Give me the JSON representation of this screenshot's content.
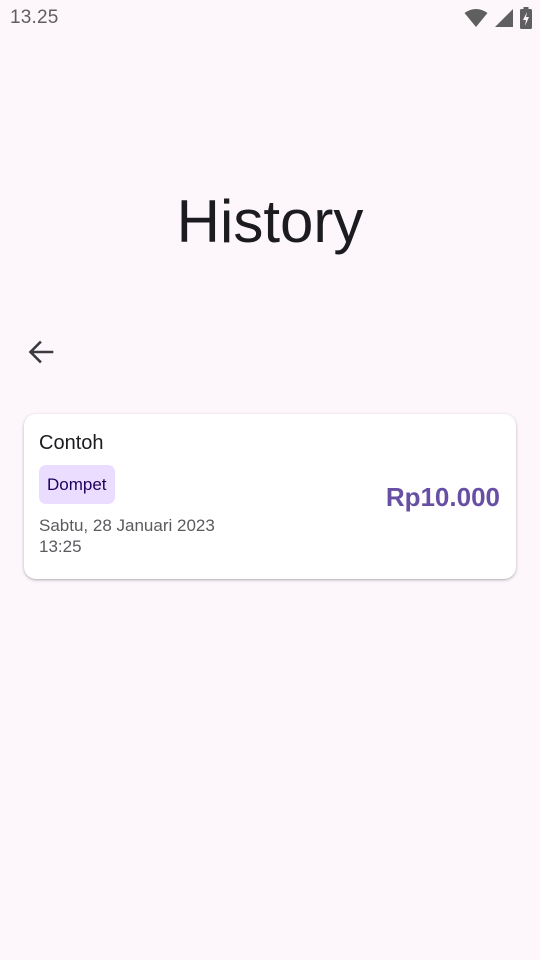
{
  "status_bar": {
    "time": "13.25",
    "icons": [
      "wifi-icon",
      "signal-icon",
      "battery-charging-icon"
    ]
  },
  "page": {
    "title": "History",
    "back_icon": "arrow-back-icon"
  },
  "transactions": [
    {
      "name": "Contoh",
      "category": "Dompet",
      "date": "Sabtu, 28 Januari 2023",
      "time": "13:25",
      "amount": "Rp10.000"
    }
  ],
  "colors": {
    "background": "#fdf7fc",
    "accent": "#6750a4",
    "chip_background": "#eaddff",
    "chip_text": "#21005d"
  }
}
